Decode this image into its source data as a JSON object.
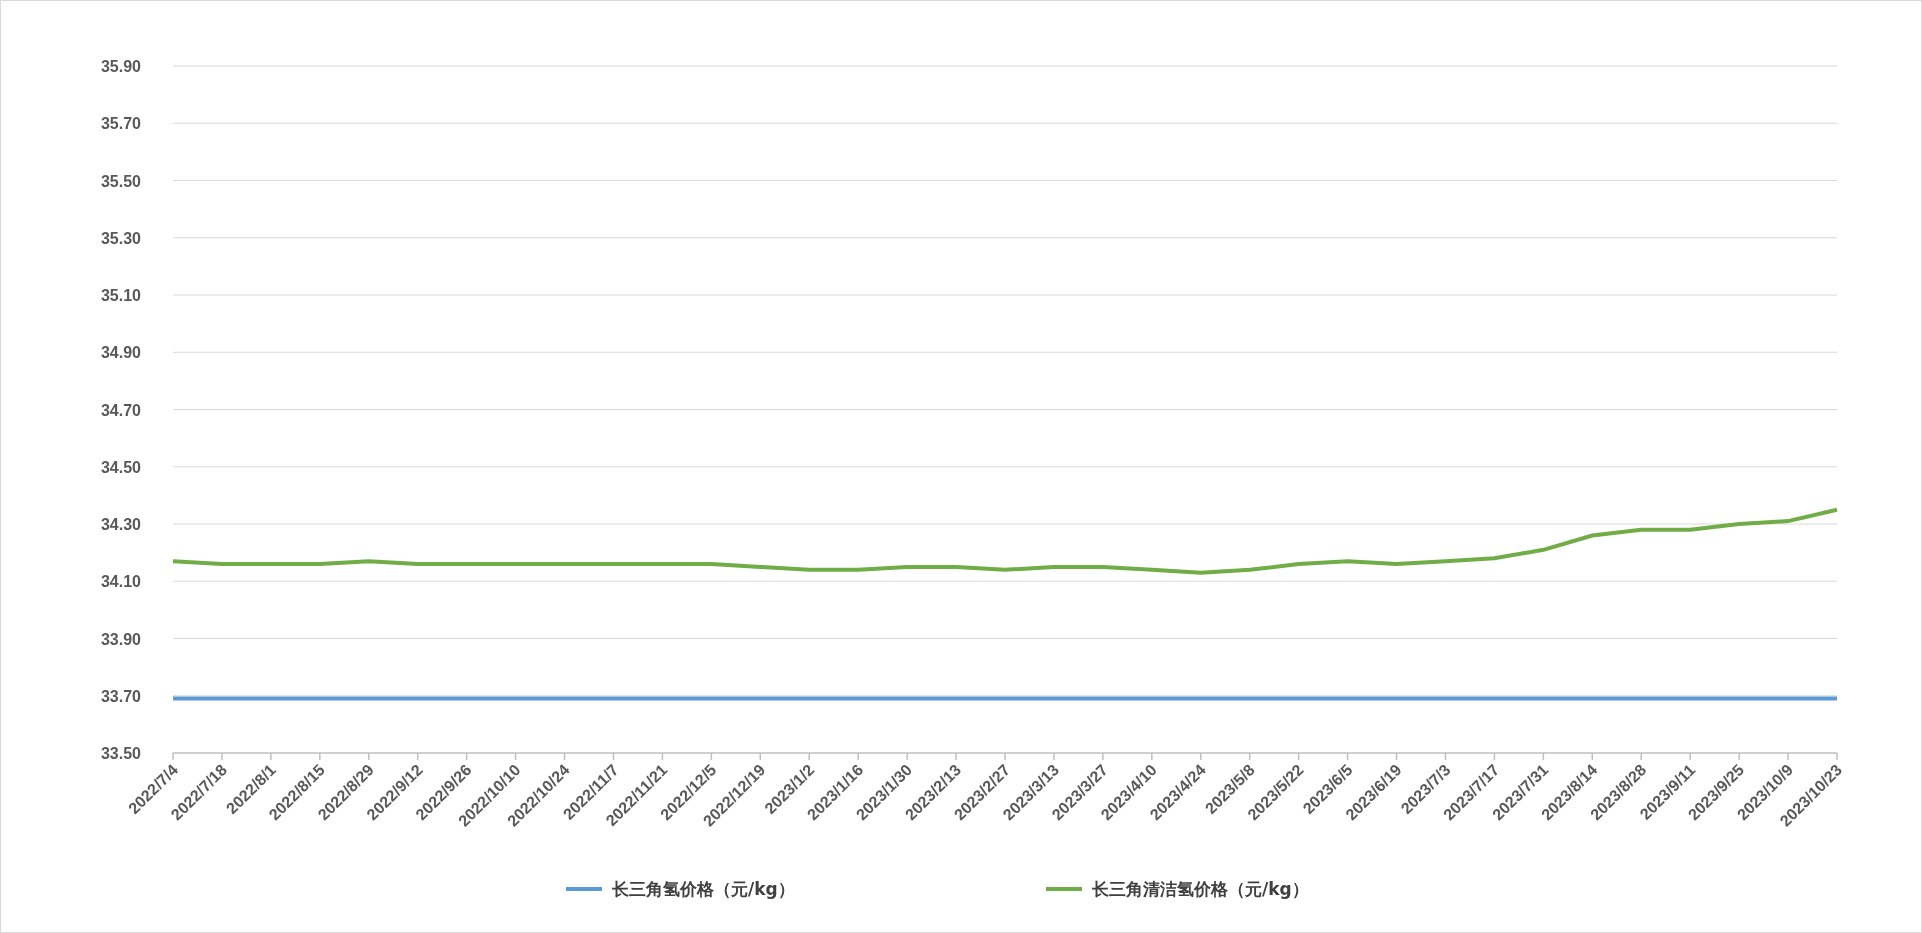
{
  "chart_data": {
    "type": "line",
    "grid": true,
    "legend": true,
    "categories": [
      "2022/7/4",
      "2022/7/18",
      "2022/8/1",
      "2022/8/15",
      "2022/8/29",
      "2022/9/12",
      "2022/9/26",
      "2022/10/10",
      "2022/10/24",
      "2022/11/7",
      "2022/11/21",
      "2022/12/5",
      "2022/12/19",
      "2023/1/2",
      "2023/1/16",
      "2023/1/30",
      "2023/2/13",
      "2023/2/27",
      "2023/3/13",
      "2023/3/27",
      "2023/4/10",
      "2023/4/24",
      "2023/5/8",
      "2023/5/22",
      "2023/6/5",
      "2023/6/19",
      "2023/7/3",
      "2023/7/17",
      "2023/7/31",
      "2023/8/14",
      "2023/8/28",
      "2023/9/11",
      "2023/9/25",
      "2023/10/9",
      "2023/10/23"
    ],
    "series": [
      {
        "name": "长三角氢价格（元/kg）",
        "color": "#5b9bd5",
        "values": [
          33.69,
          33.69,
          33.69,
          33.69,
          33.69,
          33.69,
          33.69,
          33.69,
          33.69,
          33.69,
          33.69,
          33.69,
          33.69,
          33.69,
          33.69,
          33.69,
          33.69,
          33.69,
          33.69,
          33.69,
          33.69,
          33.69,
          33.69,
          33.69,
          33.69,
          33.69,
          33.69,
          33.69,
          33.69,
          33.69,
          33.69,
          33.69,
          33.69,
          33.69,
          33.69
        ]
      },
      {
        "name": "长三角清洁氢价格（元/kg）",
        "color": "#70ad47",
        "values": [
          34.17,
          34.16,
          34.16,
          34.16,
          34.17,
          34.16,
          34.16,
          34.16,
          34.16,
          34.16,
          34.16,
          34.16,
          34.15,
          34.14,
          34.14,
          34.15,
          34.15,
          34.14,
          34.15,
          34.15,
          34.14,
          34.13,
          34.14,
          34.16,
          34.17,
          34.16,
          34.17,
          34.18,
          34.21,
          34.26,
          34.28,
          34.28,
          34.3,
          34.31,
          34.35
        ]
      }
    ],
    "ylim": [
      33.5,
      35.9
    ],
    "yticks": [
      {
        "value": 33.5,
        "label": "33.50"
      },
      {
        "value": 33.7,
        "label": "33.70"
      },
      {
        "value": 33.9,
        "label": "33.90"
      },
      {
        "value": 34.1,
        "label": "34.10"
      },
      {
        "value": 34.3,
        "label": "34.30"
      },
      {
        "value": 34.5,
        "label": "34.50"
      },
      {
        "value": 34.7,
        "label": "34.70"
      },
      {
        "value": 34.9,
        "label": "34.90"
      },
      {
        "value": 35.1,
        "label": "35.10"
      },
      {
        "value": 35.3,
        "label": "35.30"
      },
      {
        "value": 35.5,
        "label": "35.50"
      },
      {
        "value": 35.7,
        "label": "35.70"
      },
      {
        "value": 35.9,
        "label": "35.90"
      }
    ]
  }
}
